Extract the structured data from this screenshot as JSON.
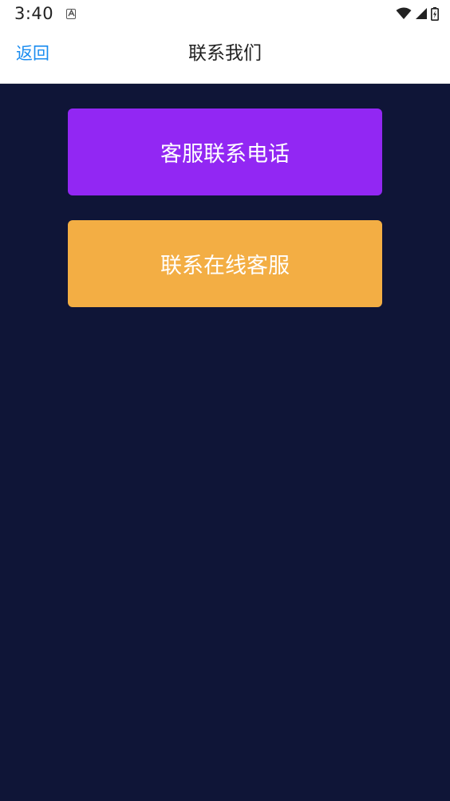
{
  "status_bar": {
    "time": "3:40",
    "icons": [
      "notification-a-icon",
      "wifi-icon",
      "signal-icon",
      "battery-charging-icon"
    ]
  },
  "header": {
    "back_label": "返回",
    "title": "联系我们"
  },
  "main": {
    "background": "#0f1537",
    "buttons": [
      {
        "label": "客服联系电话",
        "color": "#9227f3"
      },
      {
        "label": "联系在线客服",
        "color": "#f3ae44"
      }
    ]
  },
  "colors": {
    "link": "#1a8cf0"
  }
}
